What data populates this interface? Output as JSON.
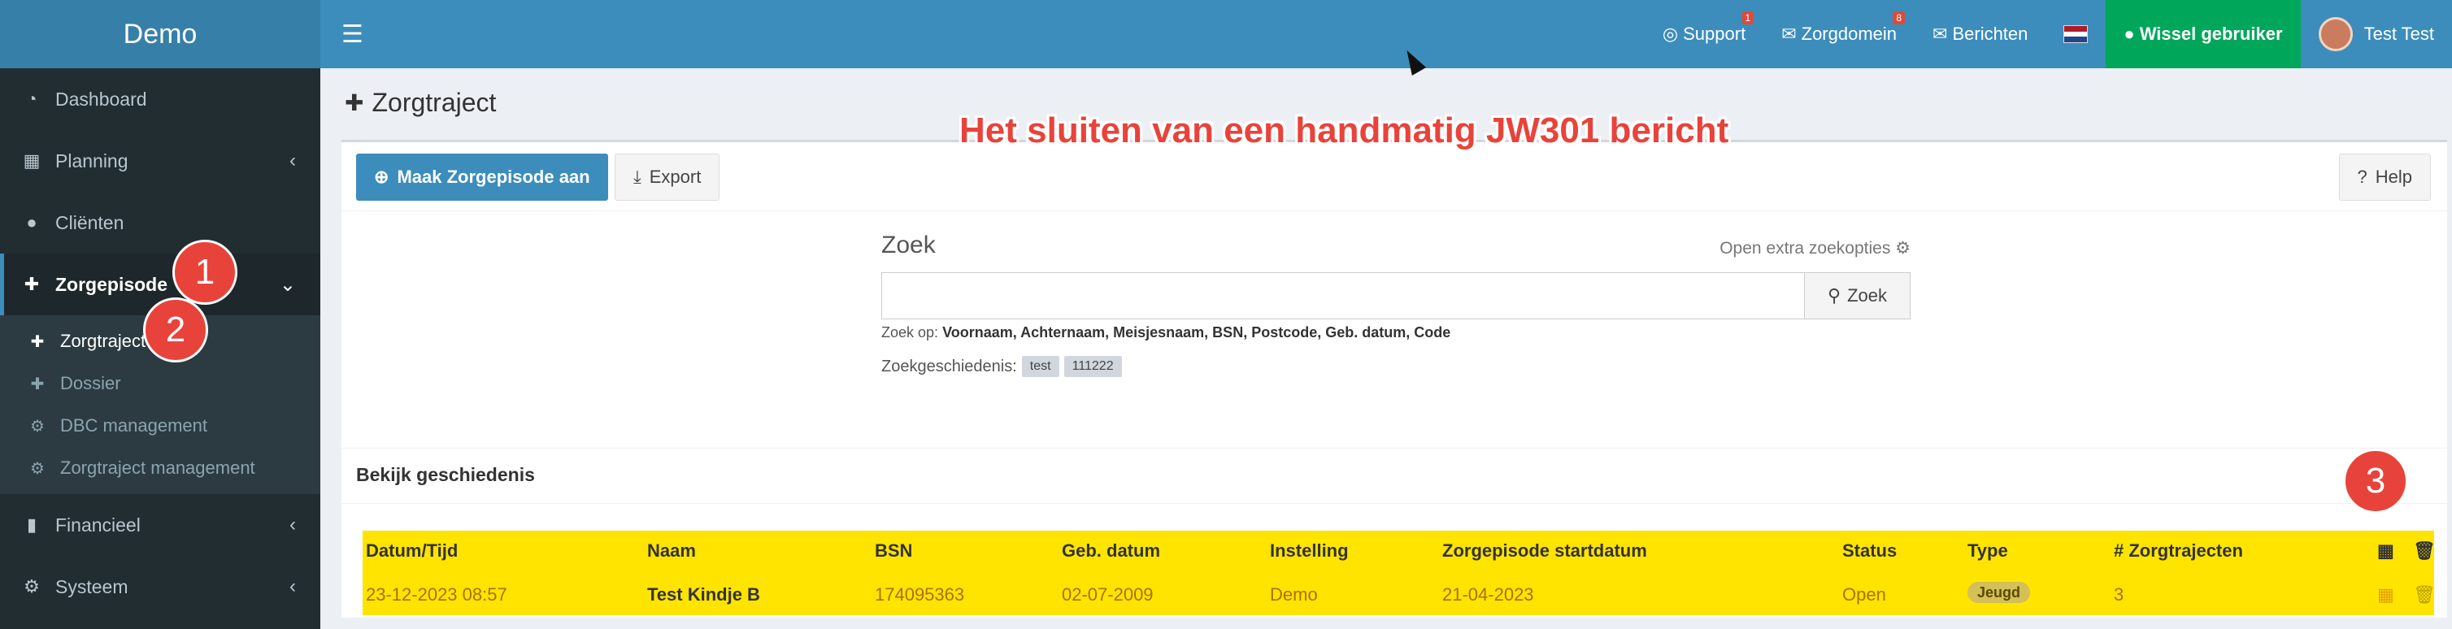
{
  "app": {
    "name": "Demo"
  },
  "sidebar": {
    "items": [
      {
        "label": "Dashboard",
        "icon": "dashboard-icon"
      },
      {
        "label": "Planning",
        "icon": "calendar-icon"
      },
      {
        "label": "Cliënten",
        "icon": "user-icon"
      },
      {
        "label": "Zorgepisode",
        "icon": "medkit-icon"
      },
      {
        "label": "Financieel",
        "icon": "book-icon"
      },
      {
        "label": "Systeem",
        "icon": "gears-icon"
      }
    ],
    "submenu": [
      {
        "label": "Zorgtraject",
        "icon": "medkit-icon"
      },
      {
        "label": "Dossier",
        "icon": "medkit-icon"
      },
      {
        "label": "DBC management",
        "icon": "gear-icon"
      },
      {
        "label": "Zorgtraject management",
        "icon": "gear-icon"
      }
    ]
  },
  "header": {
    "support_label": "Support",
    "support_badge": "1",
    "zorgdomein_label": "Zorgdomein",
    "zorgdomein_badge": "8",
    "berichten_label": "Berichten",
    "switch_user_label": "Wissel gebruiker",
    "user_name": "Test Test"
  },
  "page": {
    "title": "Zorgtraject",
    "overlay_title": "Het sluiten van een handmatig JW301 bericht",
    "create_button": "Maak Zorgepisode aan",
    "export_button": "Export",
    "help_button": "Help"
  },
  "search": {
    "label": "Zoek",
    "extra_options": "Open extra zoekopties",
    "value": "",
    "button": "Zoek",
    "help_prefix": "Zoek op:",
    "help_fields": "Voornaam, Achternaam, Meisjesnaam, BSN, Postcode, Geb. datum, Code",
    "history_label": "Zoekgeschiedenis:",
    "history_tags": [
      "test",
      "111222"
    ]
  },
  "history_section": {
    "title": "Bekijk geschiedenis"
  },
  "table": {
    "headers": [
      "Datum/Tijd",
      "Naam",
      "BSN",
      "Geb. datum",
      "Instelling",
      "Zorgepisode startdatum",
      "Status",
      "Type",
      "# Zorgtrajecten"
    ],
    "rows": [
      [
        "23-12-2023 08:57",
        "Test Kindje B",
        "174095363",
        "02-07-2009",
        "Demo",
        "21-04-2023",
        "Open",
        "Jeugd",
        "3"
      ]
    ]
  },
  "callouts": [
    "1",
    "2",
    "3"
  ],
  "colors": {
    "header": "#3c8dbc",
    "sidebar": "#222d32",
    "highlight": "#ffe400",
    "callout": "#e8433b",
    "switch": "#00a65a"
  }
}
